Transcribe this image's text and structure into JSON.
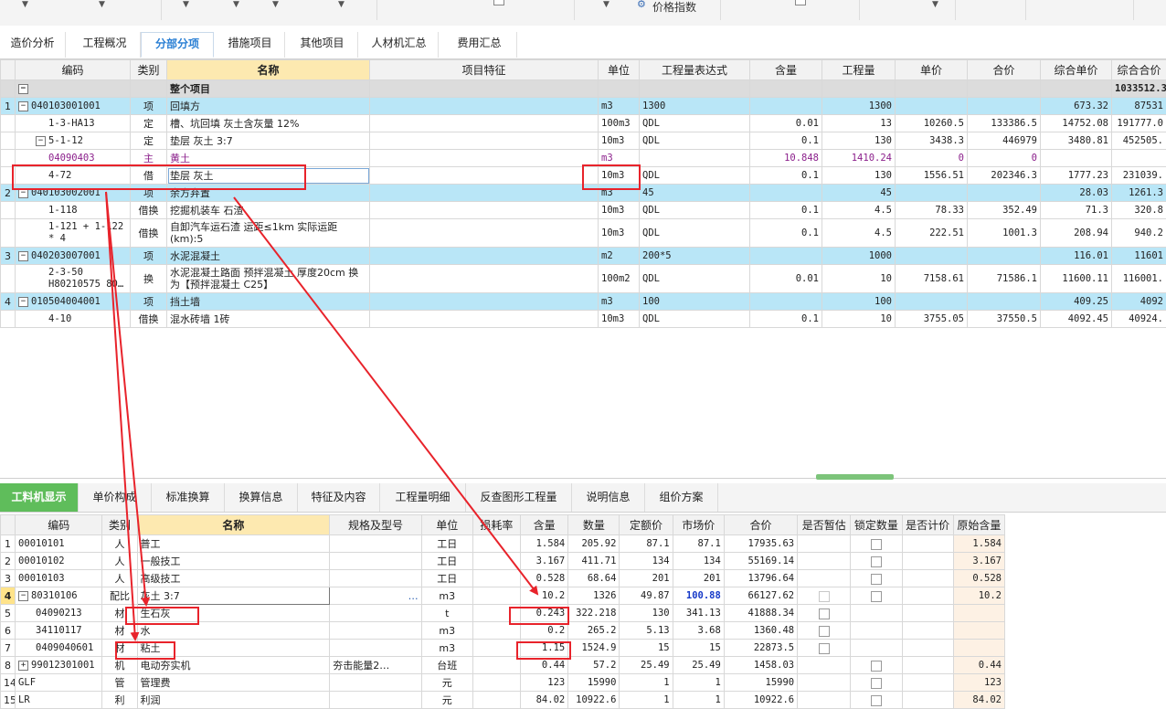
{
  "toolbar": {
    "price_index_label": "价格指数"
  },
  "tabs": [
    "造价分析",
    "工程概况",
    "分部分项",
    "措施项目",
    "其他项目",
    "人材机汇总",
    "费用汇总"
  ],
  "top_table": {
    "headers": [
      "编码",
      "类别",
      "名称",
      "项目特征",
      "单位",
      "工程量表达式",
      "含量",
      "工程量",
      "单价",
      "合价",
      "综合单价",
      "综合合价"
    ],
    "rows": [
      {
        "num": "",
        "code": "",
        "type": "",
        "name": "整个项目",
        "unit": "",
        "expr": "",
        "qty_ratio": "",
        "qty": "",
        "price": "",
        "total": "",
        "comp_price": "",
        "comp_total": "1033512.3"
      },
      {
        "num": "1",
        "code": "040103001001",
        "type": "项",
        "name": "回填方",
        "unit": "m3",
        "expr": "1300",
        "qty_ratio": "",
        "qty": "1300",
        "price": "",
        "total": "",
        "comp_price": "673.32",
        "comp_total": "87531"
      },
      {
        "num": "",
        "code": "1-3-HA13",
        "type": "定",
        "name": "槽、坑回填 灰土含灰量 12%",
        "unit": "100m3",
        "expr": "QDL",
        "qty_ratio": "0.01",
        "qty": "13",
        "price": "10260.5",
        "total": "133386.5",
        "comp_price": "14752.08",
        "comp_total": "191777.0"
      },
      {
        "num": "",
        "code": "5-1-12",
        "type": "定",
        "name": "垫层 灰土 3:7",
        "unit": "10m3",
        "expr": "QDL",
        "qty_ratio": "0.1",
        "qty": "130",
        "price": "3438.3",
        "total": "446979",
        "comp_price": "3480.81",
        "comp_total": "452505."
      },
      {
        "num": "",
        "code": "04090403",
        "type": "主",
        "name": "黄土",
        "unit": "m3",
        "expr": "",
        "qty_ratio": "10.848",
        "qty": "1410.24",
        "price": "0",
        "total": "0",
        "comp_price": "",
        "comp_total": ""
      },
      {
        "num": "",
        "code": "4-72",
        "type": "借",
        "name": "垫层 灰土",
        "unit": "10m3",
        "expr": "QDL",
        "qty_ratio": "0.1",
        "qty": "130",
        "price": "1556.51",
        "total": "202346.3",
        "comp_price": "1777.23",
        "comp_total": "231039."
      },
      {
        "num": "2",
        "code": "040103002001",
        "type": "项",
        "name": "余方弃置",
        "unit": "m3",
        "expr": "45",
        "qty_ratio": "",
        "qty": "45",
        "price": "",
        "total": "",
        "comp_price": "28.03",
        "comp_total": "1261.3"
      },
      {
        "num": "",
        "code": "1-118",
        "type": "借换",
        "name": "挖掘机装车 石渣",
        "unit": "10m3",
        "expr": "QDL",
        "qty_ratio": "0.1",
        "qty": "4.5",
        "price": "78.33",
        "total": "352.49",
        "comp_price": "71.3",
        "comp_total": "320.8"
      },
      {
        "num": "",
        "code": "1-121 + 1-122 * 4",
        "type": "借换",
        "name": "自卸汽车运石渣 运距≤1km  实际运距(km):5",
        "unit": "10m3",
        "expr": "QDL",
        "qty_ratio": "0.1",
        "qty": "4.5",
        "price": "222.51",
        "total": "1001.3",
        "comp_price": "208.94",
        "comp_total": "940.2"
      },
      {
        "num": "3",
        "code": "040203007001",
        "type": "项",
        "name": "水泥混凝土",
        "unit": "m2",
        "expr": "200*5",
        "qty_ratio": "",
        "qty": "1000",
        "price": "",
        "total": "",
        "comp_price": "116.01",
        "comp_total": "11601"
      },
      {
        "num": "",
        "code": "2-3-50 H80210575 80…",
        "type": "换",
        "name": "水泥混凝土路面 预拌混凝土 厚度20cm 换为【预拌混凝土 C25】",
        "unit": "100m2",
        "expr": "QDL",
        "qty_ratio": "0.01",
        "qty": "10",
        "price": "7158.61",
        "total": "71586.1",
        "comp_price": "11600.11",
        "comp_total": "116001."
      },
      {
        "num": "4",
        "code": "010504004001",
        "type": "项",
        "name": "挡土墙",
        "unit": "m3",
        "expr": "100",
        "qty_ratio": "",
        "qty": "100",
        "price": "",
        "total": "",
        "comp_price": "409.25",
        "comp_total": "4092"
      },
      {
        "num": "",
        "code": "4-10",
        "type": "借换",
        "name": "混水砖墙 1砖",
        "unit": "10m3",
        "expr": "QDL",
        "qty_ratio": "0.1",
        "qty": "10",
        "price": "3755.05",
        "total": "37550.5",
        "comp_price": "4092.45",
        "comp_total": "40924."
      }
    ]
  },
  "bottom_tabs": [
    "工料机显示",
    "单价构成",
    "标准换算",
    "换算信息",
    "特征及内容",
    "工程量明细",
    "反查图形工程量",
    "说明信息",
    "组价方案"
  ],
  "bottom_table": {
    "headers": [
      "编码",
      "类别",
      "名称",
      "规格及型号",
      "单位",
      "损耗率",
      "含量",
      "数量",
      "定额价",
      "市场价",
      "合价",
      "是否暂估",
      "锁定数量",
      "是否计价",
      "原始含量"
    ],
    "rows": [
      {
        "num": "1",
        "code": "00010101",
        "type": "人",
        "name": "普工",
        "spec": "",
        "unit": "工日",
        "loss": "",
        "ratio": "1.584",
        "qty": "205.92",
        "quota": "87.1",
        "market": "87.1",
        "total": "17935.63",
        "orig": "1.584"
      },
      {
        "num": "2",
        "code": "00010102",
        "type": "人",
        "name": "一般技工",
        "spec": "",
        "unit": "工日",
        "loss": "",
        "ratio": "3.167",
        "qty": "411.71",
        "quota": "134",
        "market": "134",
        "total": "55169.14",
        "orig": "3.167"
      },
      {
        "num": "3",
        "code": "00010103",
        "type": "人",
        "name": "高级技工",
        "spec": "",
        "unit": "工日",
        "loss": "",
        "ratio": "0.528",
        "qty": "68.64",
        "quota": "201",
        "market": "201",
        "total": "13796.64",
        "orig": "0.528"
      },
      {
        "num": "4",
        "code": "80310106",
        "type": "配比",
        "name": "灰土 3:7",
        "spec": "…",
        "unit": "m3",
        "loss": "",
        "ratio": "10.2",
        "qty": "1326",
        "quota": "49.87",
        "market": "100.88",
        "total": "66127.62",
        "orig": "10.2"
      },
      {
        "num": "5",
        "code": "04090213",
        "type": "材",
        "name": "生石灰",
        "spec": "",
        "unit": "t",
        "loss": "",
        "ratio": "0.243",
        "qty": "322.218",
        "quota": "130",
        "market": "341.13",
        "total": "41888.34",
        "orig": ""
      },
      {
        "num": "6",
        "code": "34110117",
        "type": "材",
        "name": "水",
        "spec": "",
        "unit": "m3",
        "loss": "",
        "ratio": "0.2",
        "qty": "265.2",
        "quota": "5.13",
        "market": "3.68",
        "total": "1360.48",
        "orig": ""
      },
      {
        "num": "7",
        "code": "0409040601",
        "type": "材",
        "name": "粘土",
        "spec": "",
        "unit": "m3",
        "loss": "",
        "ratio": "1.15",
        "qty": "1524.9",
        "quota": "15",
        "market": "15",
        "total": "22873.5",
        "orig": ""
      },
      {
        "num": "8",
        "code": "99012301001",
        "type": "机",
        "name": "电动夯实机",
        "spec": "夯击能量2…",
        "unit": "台班",
        "loss": "",
        "ratio": "0.44",
        "qty": "57.2",
        "quota": "25.49",
        "market": "25.49",
        "total": "1458.03",
        "orig": "0.44"
      },
      {
        "num": "14",
        "code": "GLF",
        "type": "管",
        "name": "管理费",
        "spec": "",
        "unit": "元",
        "loss": "",
        "ratio": "123",
        "qty": "15990",
        "quota": "1",
        "market": "1",
        "total": "15990",
        "orig": "123"
      },
      {
        "num": "15",
        "code": "LR",
        "type": "利",
        "name": "利润",
        "spec": "",
        "unit": "元",
        "loss": "",
        "ratio": "84.02",
        "qty": "10922.6",
        "quota": "1",
        "market": "1",
        "total": "10922.6",
        "orig": "84.02"
      }
    ]
  },
  "annotation_color": "#e8232b"
}
